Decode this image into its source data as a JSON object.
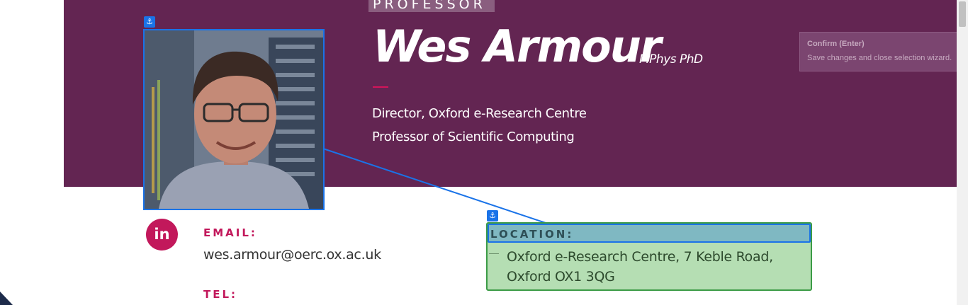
{
  "profile": {
    "eyebrow": "PROFESSOR",
    "name": "Wes Armour",
    "postnominals": "MPhys PhD",
    "roles": [
      "Director, Oxford e-Research Centre",
      "Professor of Scientific Computing"
    ]
  },
  "tooltip": {
    "title": "Confirm (Enter)",
    "text": "Save changes and close selection wizard."
  },
  "contact": {
    "email_label": "EMAIL:",
    "email": "wes.armour@oerc.ox.ac.uk",
    "tel_label": "TEL:",
    "location_label": "LOCATION:",
    "location": "Oxford e-Research Centre, 7 Keble Road, Oxford OX1 3QG",
    "linkedin_text": "in"
  },
  "overlay": {
    "anchor_glyph": "⚓"
  },
  "colors": {
    "hero_bg": "#632552",
    "accent": "#c2185b",
    "selection_blue": "#1a73e8",
    "selection_green": "#b5deb3"
  }
}
